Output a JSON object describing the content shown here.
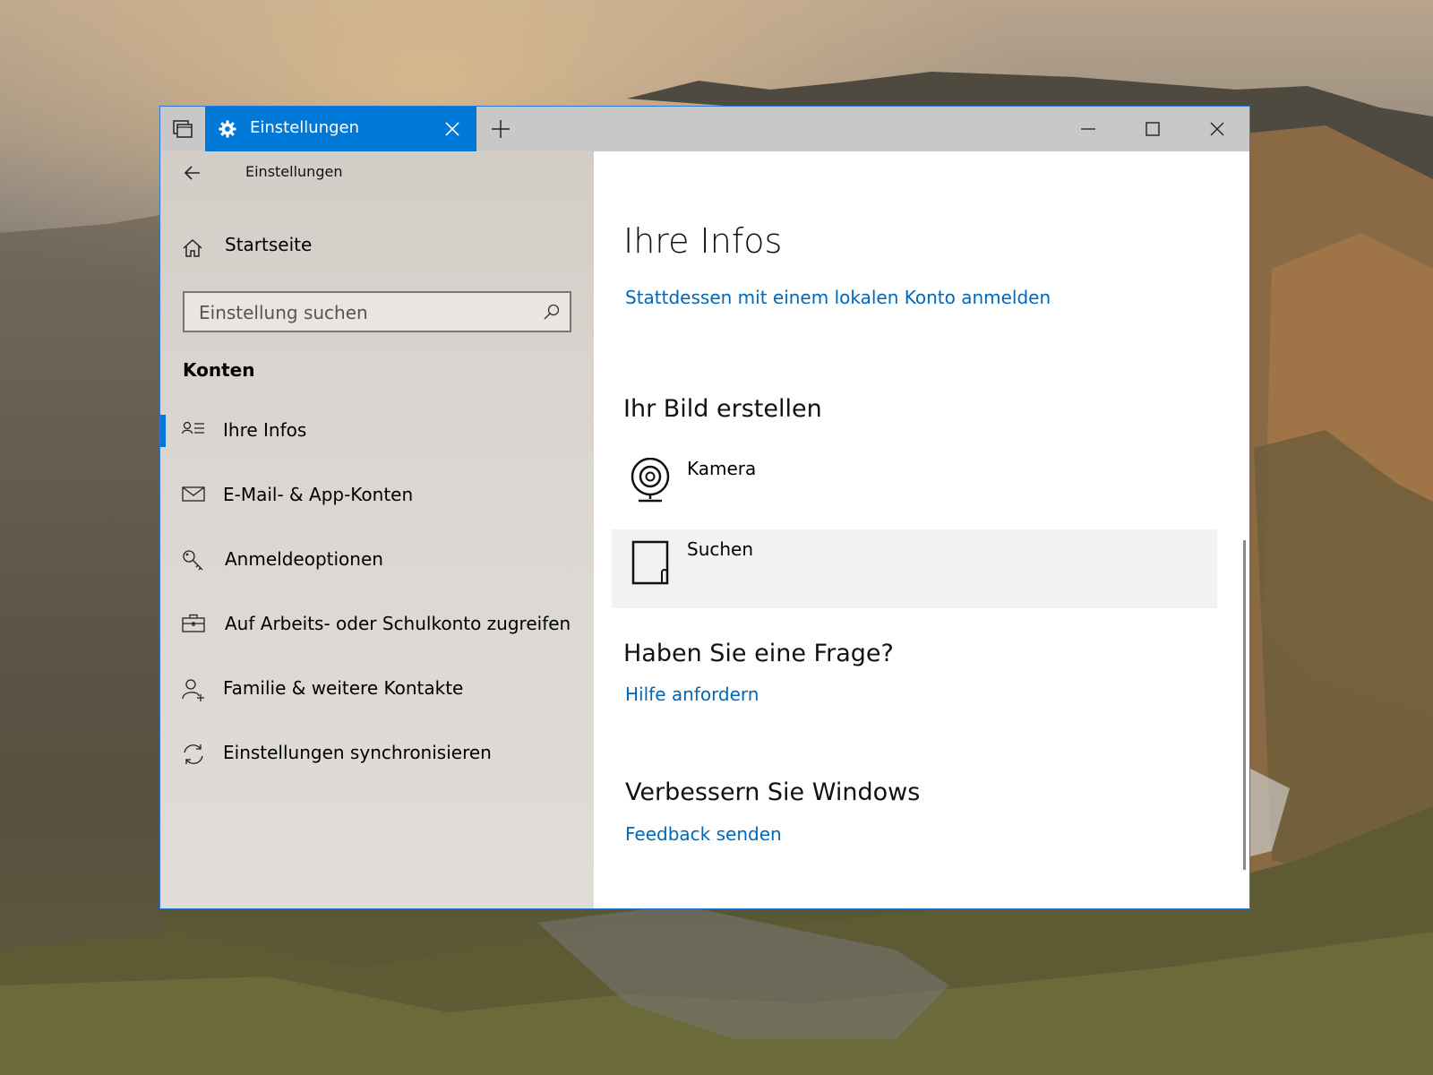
{
  "titlebar": {
    "tab_title": "Einstellungen"
  },
  "sidebar": {
    "breadcrumb": "Einstellungen",
    "home_label": "Startseite",
    "search_placeholder": "Einstellung suchen",
    "section_title": "Konten",
    "items": [
      {
        "label": "Ihre Infos",
        "icon": "contact-info-icon",
        "selected": true
      },
      {
        "label": "E-Mail- & App-Konten",
        "icon": "mail-icon",
        "selected": false
      },
      {
        "label": "Anmeldeoptionen",
        "icon": "key-icon",
        "selected": false
      },
      {
        "label": "Auf Arbeits- oder Schulkonto zugreifen",
        "icon": "briefcase-icon",
        "selected": false
      },
      {
        "label": "Familie & weitere Kontakte",
        "icon": "add-person-icon",
        "selected": false
      },
      {
        "label": "Einstellungen synchronisieren",
        "icon": "sync-icon",
        "selected": false
      }
    ]
  },
  "main": {
    "title": "Ihre Infos",
    "local_account_link": "Stattdessen mit einem lokalen Konto anmelden",
    "picture_heading": "Ihr Bild erstellen",
    "picture_options": [
      {
        "label": "Kamera",
        "icon": "webcam-icon",
        "hovered": false
      },
      {
        "label": "Suchen",
        "icon": "browse-file-icon",
        "hovered": true
      }
    ],
    "question_heading": "Haben Sie eine Frage?",
    "help_link": "Hilfe anfordern",
    "improve_heading": "Verbessern Sie Windows",
    "feedback_link": "Feedback senden"
  },
  "colors": {
    "accent": "#0078d7",
    "link": "#0067b8",
    "titlebar": "#c8c8c8",
    "hover_row": "#f2f2f2"
  }
}
